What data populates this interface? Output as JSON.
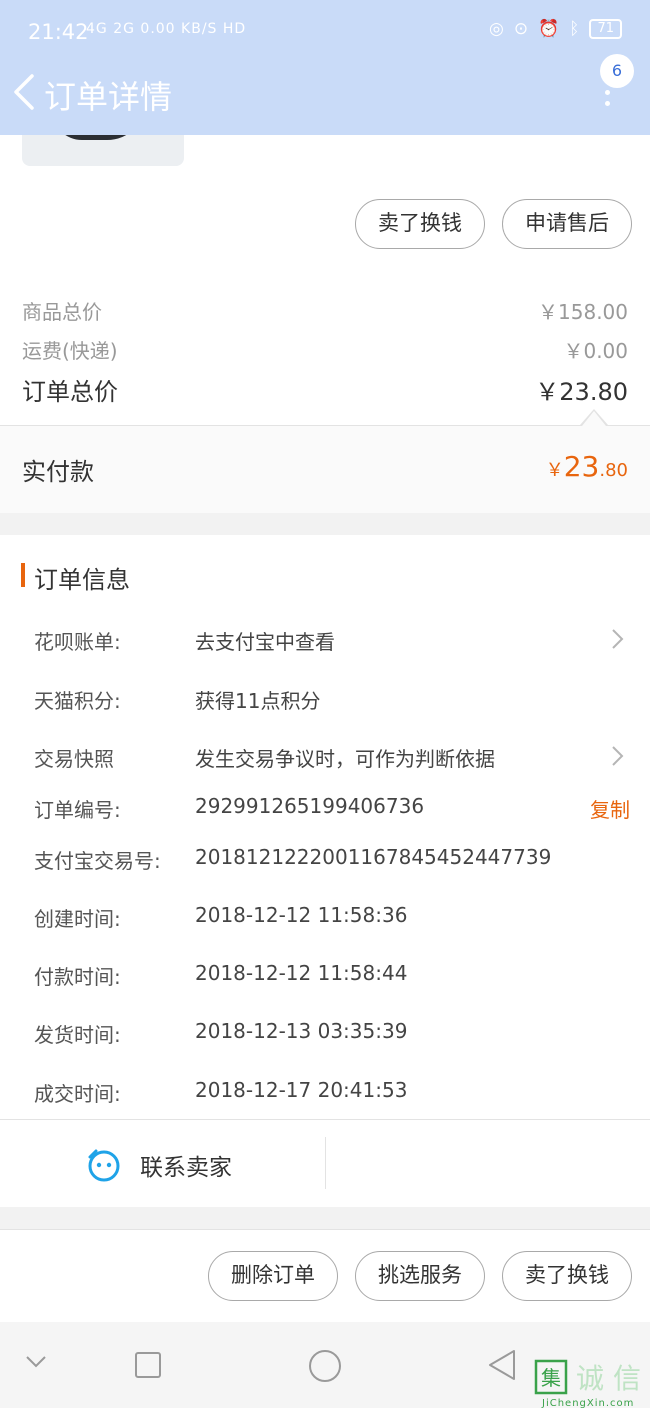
{
  "status_bar": {
    "time": "21:42",
    "network": "4G  2G  0.00 KB/S  HD",
    "battery": "71"
  },
  "header": {
    "title": "订单详情",
    "badge_count": "6"
  },
  "action_buttons_top": [
    {
      "label": "卖了换钱"
    },
    {
      "label": "申请售后"
    }
  ],
  "price_summary": {
    "goods_total_label": "商品总价",
    "goods_total_value": "￥158.00",
    "shipping_label": "运费(快递)",
    "shipping_value": "￥0.00",
    "order_total_label": "订单总价",
    "order_total_value": "￥23.80"
  },
  "paid": {
    "label": "实付款",
    "currency": "￥",
    "integer": "23",
    "decimal": ".80",
    "color": "#e8650e"
  },
  "order_info": {
    "title": "订单信息",
    "rows": [
      {
        "key": "花呗账单:",
        "value": "去支付宝中查看",
        "chevron": true
      },
      {
        "key": "天猫积分:",
        "value": "获得11点积分"
      },
      {
        "key": "交易快照",
        "value": "发生交易争议时，可作为判断依据",
        "chevron": true
      },
      {
        "key": "订单编号:",
        "value": "292991265199406736",
        "action": "复制"
      },
      {
        "key": "支付宝交易号:",
        "value": "2018121222001167845452447739"
      },
      {
        "key": "创建时间:",
        "value": "2018-12-12 11:58:36"
      },
      {
        "key": "付款时间:",
        "value": "2018-12-12 11:58:44"
      },
      {
        "key": "发货时间:",
        "value": "2018-12-13 03:35:39"
      },
      {
        "key": "成交时间:",
        "value": "2018-12-17 20:41:53"
      }
    ]
  },
  "contact": {
    "label": "联系卖家",
    "icon": "chat-face-icon",
    "icon_color": "#1fa3e8"
  },
  "action_buttons_bottom": [
    {
      "label": "删除订单"
    },
    {
      "label": "挑选服务"
    },
    {
      "label": "卖了换钱"
    }
  ],
  "watermark": {
    "chars": "集诚信",
    "url_text": "JiChengXin.com"
  },
  "colors": {
    "header_bg": "#c9dbf8",
    "accent": "#e8650e"
  }
}
